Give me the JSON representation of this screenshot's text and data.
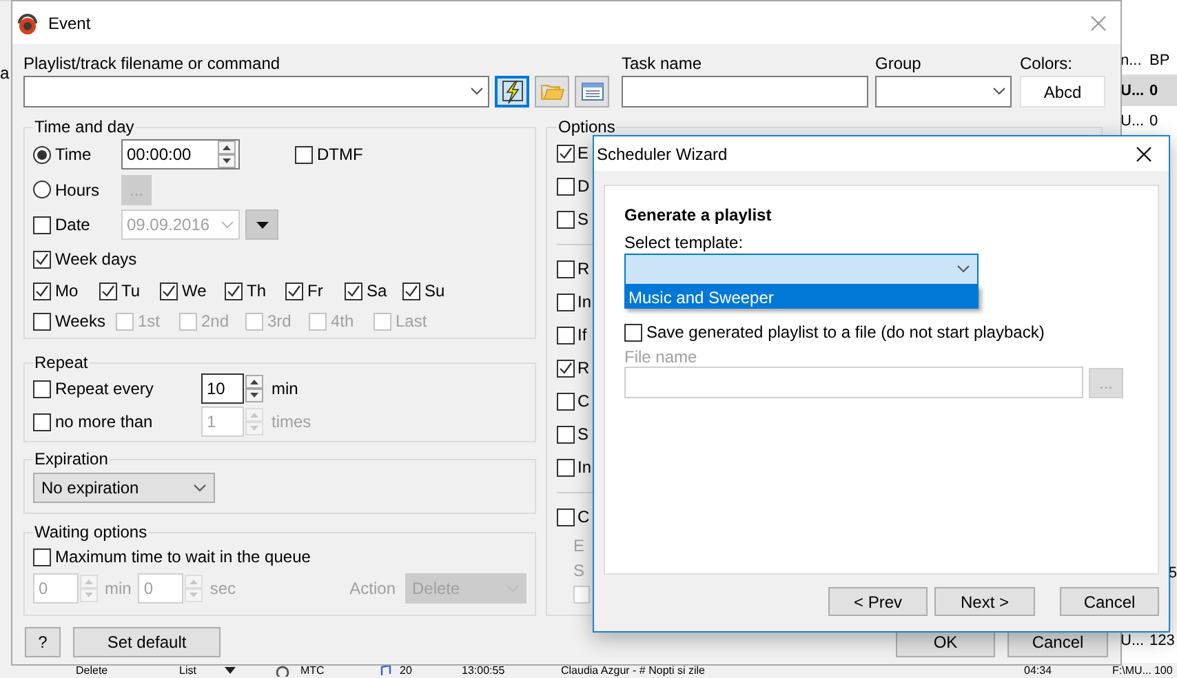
{
  "background_app": {
    "side_text": "a",
    "columns": [
      "n...",
      "BP"
    ],
    "upper_rows": [
      {
        "cells": [
          "U...",
          "0"
        ],
        "selected": true
      },
      {
        "cells": [
          "U...",
          "0"
        ],
        "selected": false
      }
    ],
    "lower_rows": [
      {
        "cells": [
          "5"
        ],
        "selected": false
      },
      {
        "cells": [
          "U...",
          "123"
        ],
        "selected": false
      }
    ],
    "toolbar": [
      "Delete",
      "List",
      "MTC"
    ],
    "track_row": {
      "number": "20",
      "time": "13:00:55",
      "title": "Claudia Azgur - # Nopti si zile",
      "duration": "04:34",
      "path": "F:\\MU...",
      "bpm": "100"
    }
  },
  "event": {
    "title": "Event",
    "command": {
      "label": "Playlist/track filename or command"
    },
    "command_buttons": [
      {
        "kind": "lightning",
        "selected": true
      },
      {
        "kind": "folder",
        "selected": false
      },
      {
        "kind": "list",
        "selected": false
      }
    ],
    "task_name": {
      "label": "Task name"
    },
    "group": {
      "label": "Group"
    },
    "colors": {
      "label": "Colors:",
      "button": "Abcd"
    },
    "time_and_day": {
      "title": "Time and day",
      "mode_options": [
        {
          "label": "Time",
          "selected": true
        },
        {
          "label": "Hours",
          "selected": false
        }
      ],
      "time_value": "00:00:00",
      "hours_button": "...",
      "dtmf": {
        "label": "DTMF",
        "checked": false
      },
      "date": {
        "label": "Date",
        "checked": false,
        "value": "09.09.2016"
      },
      "week_days": {
        "label": "Week days",
        "checked": true,
        "days": [
          {
            "label": "Mo",
            "checked": true
          },
          {
            "label": "Tu",
            "checked": true
          },
          {
            "label": "We",
            "checked": true
          },
          {
            "label": "Th",
            "checked": true
          },
          {
            "label": "Fr",
            "checked": true
          },
          {
            "label": "Sa",
            "checked": true
          },
          {
            "label": "Su",
            "checked": true
          }
        ]
      },
      "weeks": {
        "label": "Weeks",
        "checked": false,
        "items": [
          {
            "label": "1st",
            "checked": false
          },
          {
            "label": "2nd",
            "checked": false
          },
          {
            "label": "3rd",
            "checked": false
          },
          {
            "label": "4th",
            "checked": false
          },
          {
            "label": "Last",
            "checked": false
          }
        ]
      }
    },
    "repeat": {
      "title": "Repeat",
      "every": {
        "label": "Repeat every",
        "checked": false,
        "value": "10",
        "unit": "min",
        "disabled": false
      },
      "limit": {
        "label": "no more than",
        "checked": false,
        "value": "1",
        "unit": "times",
        "disabled": true
      }
    },
    "expiration": {
      "title": "Expiration",
      "value": "No expiration"
    },
    "waiting": {
      "title": "Waiting options",
      "disabled": true,
      "max_wait": {
        "label": "Maximum time to wait in the queue",
        "checked": false
      },
      "minutes": {
        "value": "0",
        "unit": "min"
      },
      "seconds": {
        "value": "0",
        "unit": "sec"
      },
      "action": {
        "label": "Action",
        "value": "Delete"
      }
    },
    "options": {
      "title": "Options",
      "items": [
        {
          "kind": "checkbox",
          "label": "E",
          "checked": true
        },
        {
          "kind": "checkbox",
          "label": "D",
          "checked": false
        },
        {
          "kind": "checkbox",
          "label": "S",
          "checked": false
        },
        {
          "kind": "divider"
        },
        {
          "kind": "checkbox",
          "label": "R",
          "checked": false
        },
        {
          "kind": "checkbox",
          "label": "In",
          "checked": false
        },
        {
          "kind": "checkbox",
          "label": "If",
          "checked": false
        },
        {
          "kind": "checkbox",
          "label": "R",
          "checked": true
        },
        {
          "kind": "checkbox",
          "label": "C",
          "checked": false
        },
        {
          "kind": "checkbox",
          "label": "S",
          "checked": false
        },
        {
          "kind": "checkbox",
          "label": "In",
          "checked": false
        },
        {
          "kind": "divider"
        },
        {
          "kind": "checkbox",
          "label": "C",
          "checked": false
        },
        {
          "kind": "text",
          "label": "E",
          "disabled": true
        },
        {
          "kind": "text",
          "label": "S",
          "disabled": true
        },
        {
          "kind": "field",
          "disabled": true
        }
      ]
    },
    "footer_buttons": [
      "?",
      "Set default"
    ],
    "dialog_buttons": [
      "OK",
      "Cancel"
    ]
  },
  "wizard": {
    "title": "Scheduler Wizard",
    "heading": "Generate a playlist",
    "template": {
      "label": "Select template:",
      "expanded": true,
      "options": [
        {
          "label": "Music and Sweeper",
          "selected": true
        }
      ]
    },
    "save_to_file": {
      "label": "Save generated playlist to a file (do not start playback)",
      "checked": false
    },
    "file_name": {
      "label": "File name",
      "disabled": true,
      "button": "..."
    },
    "buttons": [
      "< Prev",
      "Next >",
      "Cancel"
    ]
  }
}
